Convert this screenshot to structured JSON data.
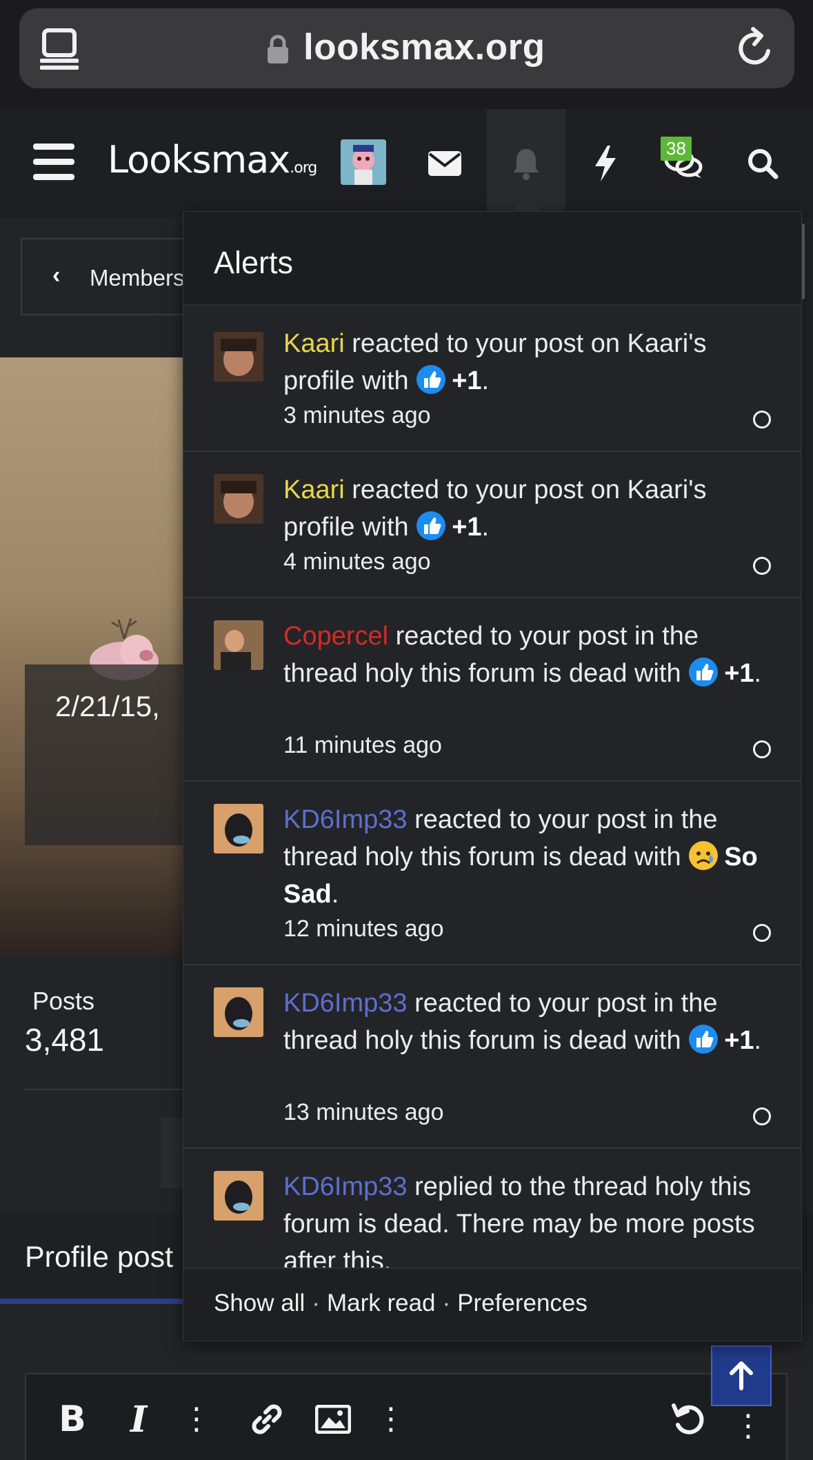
{
  "browser": {
    "url": "looksmax.org"
  },
  "header": {
    "logo_main": "Looksmax",
    "logo_suffix": ".org",
    "chat_badge": "38"
  },
  "background": {
    "breadcrumb_label": "Members",
    "date_overlay": "2/21/15, ",
    "posts_label": "Posts",
    "posts_value": "3,481",
    "profile_tab": "Profile post"
  },
  "alerts": {
    "title": "Alerts",
    "items": [
      {
        "user": "Kaari",
        "text_before": " reacted to your post on Kaari's profile with ",
        "reaction": "+1",
        "text_after": ".",
        "time": "3 minutes ago"
      },
      {
        "user": "Kaari",
        "text_before": " reacted to your post on Kaari's profile with ",
        "reaction": "+1",
        "text_after": ".",
        "time": "4 minutes ago"
      },
      {
        "user": "Copercel",
        "text_before": " reacted to your post in the thread holy this forum is dead with ",
        "reaction": "+1",
        "text_after": ".",
        "time": "11 minutes ago"
      },
      {
        "user": "KD6Imp33",
        "text_before": " reacted to your post in the thread holy this forum is dead with ",
        "reaction": "So Sad",
        "text_after": ".",
        "time": "12 minutes ago"
      },
      {
        "user": "KD6Imp33",
        "text_before": " reacted to your post in the thread holy this forum is dead with ",
        "reaction": "+1",
        "text_after": ".",
        "time": "13 minutes ago"
      },
      {
        "user": "KD6Imp33",
        "text_before": " replied to the thread holy this forum is dead. There may be more posts after this.",
        "reaction": "",
        "text_after": "",
        "time": ""
      }
    ],
    "footer": {
      "show_all": "Show all",
      "mark_read": "Mark read",
      "preferences": "Preferences",
      "separator": "·"
    }
  },
  "colors": {
    "accent": "#213b8c",
    "username_yellow": "#e8d64c",
    "username_red": "#d52b24",
    "username_blue": "#5d6fcf",
    "badge_green": "#5db83a"
  },
  "icons": {
    "tabs": "tabs-icon",
    "lock": "lock-icon",
    "reload": "reload-icon",
    "menu": "hamburger-menu-icon",
    "mail": "envelope-icon",
    "bell": "bell-icon",
    "bolt": "lightning-bolt-icon",
    "chat": "chat-bubbles-icon",
    "search": "search-icon",
    "thumbs_up": "thumbs-up-reaction-icon",
    "sad": "sad-face-reaction-icon"
  }
}
